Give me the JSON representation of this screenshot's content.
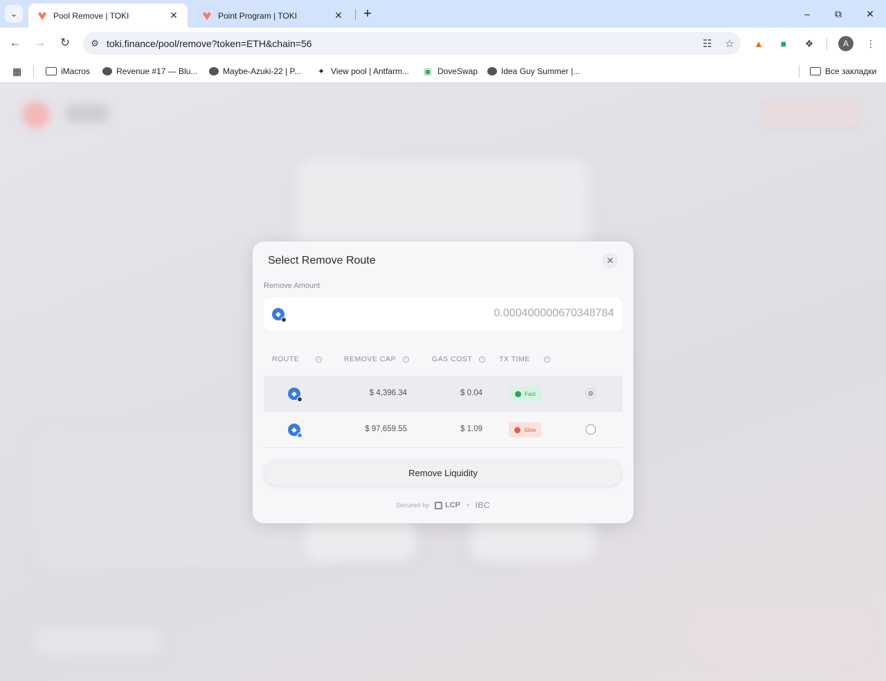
{
  "browser": {
    "tabs": [
      {
        "title": "Pool Remove | TOKI",
        "active": true
      },
      {
        "title": "Point Program | TOKI",
        "active": false
      }
    ],
    "url": "toki.finance/pool/remove?token=ETH&chain=56",
    "profile_initial": "A",
    "bookmarks": [
      {
        "label": "iMacros",
        "icon": "folder-icon"
      },
      {
        "label": "Revenue #17 — Blu...",
        "icon": "site-icon"
      },
      {
        "label": "Maybe-Azuki-22 | P...",
        "icon": "site-icon"
      },
      {
        "label": "View pool | Antfarm...",
        "icon": "site-icon"
      },
      {
        "label": "DoveSwap",
        "icon": "site-icon"
      },
      {
        "label": "Idea Guy Summer |...",
        "icon": "site-icon"
      }
    ],
    "all_bookmarks": "Все закладки"
  },
  "modal": {
    "title": "Select Remove Route",
    "amount_label": "Remove Amount",
    "amount_value": "0.000400000670348784",
    "columns": [
      "ROUTE",
      "REMOVE CAP",
      "GAS COST",
      "TX TIME"
    ],
    "routes": [
      {
        "remove_cap": "$ 4,396.34",
        "gas_cost": "$ 0.04",
        "tx_time": "Fast",
        "selected": true
      },
      {
        "remove_cap": "$ 97,659.55",
        "gas_cost": "$ 1.09",
        "tx_time": "Slow",
        "selected": false
      }
    ],
    "action_label": "Remove Liquidity",
    "secured_by": "Secured by",
    "lcp": "LCP",
    "plus": "+",
    "ibc": "IBC"
  },
  "colors": {
    "accent_fast": "#2da55c",
    "accent_slow": "#e0604c",
    "token_blue": "#3a7be0"
  }
}
